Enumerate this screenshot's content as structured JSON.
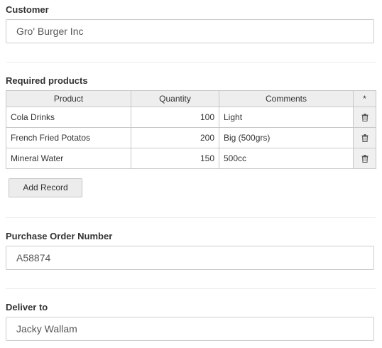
{
  "customer": {
    "label": "Customer",
    "value": "Gro' Burger Inc"
  },
  "products": {
    "label": "Required products",
    "columns": [
      "Product",
      "Quantity",
      "Comments",
      "*"
    ],
    "rows": [
      {
        "product": "Cola Drinks",
        "quantity": "100",
        "comments": "Light"
      },
      {
        "product": "French Fried Potatos",
        "quantity": "200",
        "comments": "Big (500grs)"
      },
      {
        "product": "Mineral Water",
        "quantity": "150",
        "comments": "500cc"
      }
    ],
    "delete_icon": "trash-icon",
    "add_button": "Add Record"
  },
  "purchase_order": {
    "label": "Purchase Order Number",
    "value": "A58874"
  },
  "deliver_to": {
    "label": "Deliver to",
    "value": "Jacky Wallam"
  }
}
